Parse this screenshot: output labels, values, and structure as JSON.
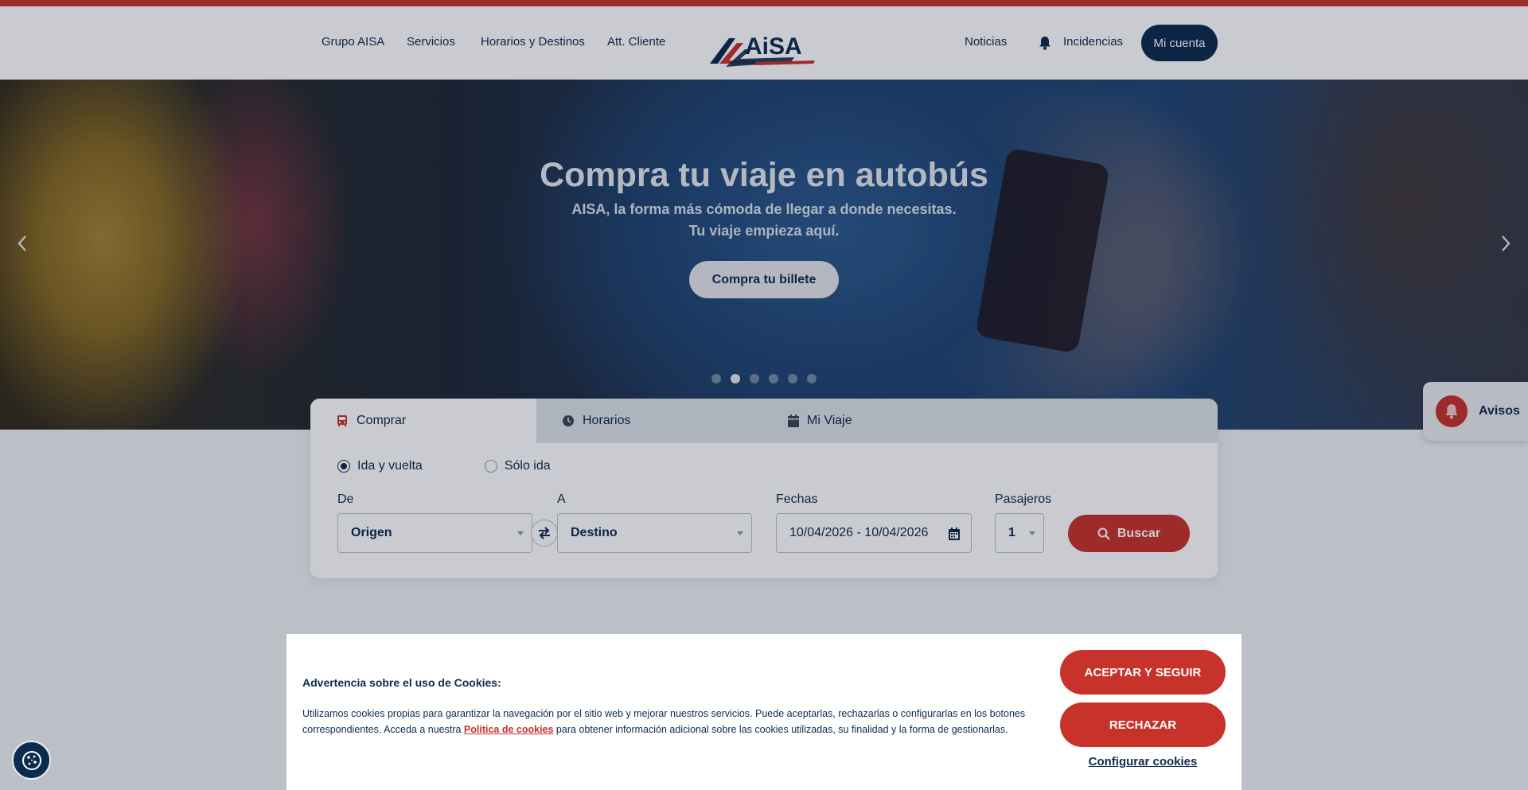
{
  "colors": {
    "brand_red": "#c7322b",
    "brand_navy": "#0d2b4e",
    "tab_bar": "#dde2e8"
  },
  "header": {
    "nav_left": [
      "Grupo AISA",
      "Servicios",
      "Horarios y Destinos",
      "Att. Cliente"
    ],
    "logo_text": "AiSA",
    "nav_news": "Noticias",
    "nav_incidents": "Incidencias",
    "account_label": "Mi cuenta",
    "icons": {
      "incidents": "bell-icon"
    }
  },
  "hero": {
    "title": "Compra tu viaje en autobús",
    "subtitle_1": "AISA, la forma más cómoda de llegar a donde necesitas.",
    "subtitle_2": "Tu viaje empieza aquí.",
    "cta_label": "Compra tu billete",
    "slide_count": 6,
    "active_slide": 2,
    "icons": {
      "prev": "chevron-left-icon",
      "next": "chevron-right-icon"
    }
  },
  "avisos": {
    "label": "Avisos",
    "icon": "bell-icon"
  },
  "booking": {
    "tabs": [
      {
        "label": "Comprar",
        "icon": "bus-icon",
        "active": true
      },
      {
        "label": "Horarios",
        "icon": "clock-icon",
        "active": false
      },
      {
        "label": "Mi Viaje",
        "icon": "calendar-icon",
        "active": false
      }
    ],
    "trip_types": [
      {
        "label": "Ida y vuelta",
        "selected": true
      },
      {
        "label": "Sólo ida",
        "selected": false
      }
    ],
    "from_label": "De",
    "from_value": "Origen",
    "to_label": "A",
    "to_value": "Destino",
    "dates_label": "Fechas",
    "dates_value": "10/04/2026 - 10/04/2026",
    "passengers_label": "Pasajeros",
    "passengers_value": "1",
    "search_label": "Buscar"
  },
  "cookies": {
    "title": "Advertencia sobre el uso de Cookies:",
    "text_before": "Utilizamos cookies propias para garantizar la navegación por el sitio web y mejorar nuestros servicios. Puede aceptarlas, rechazarlas o configurarlas en los botones correspondientes. Acceda a nuestra ",
    "link_text": "Política de cookies",
    "text_after": " para obtener información adicional sobre las cookies utilizadas, su finalidad y la forma de gestionarlas.",
    "accept_label": "ACEPTAR Y SEGUIR",
    "reject_label": "RECHAZAR",
    "configure_label": "Configurar cookies",
    "fab_icon": "cookie-icon"
  }
}
